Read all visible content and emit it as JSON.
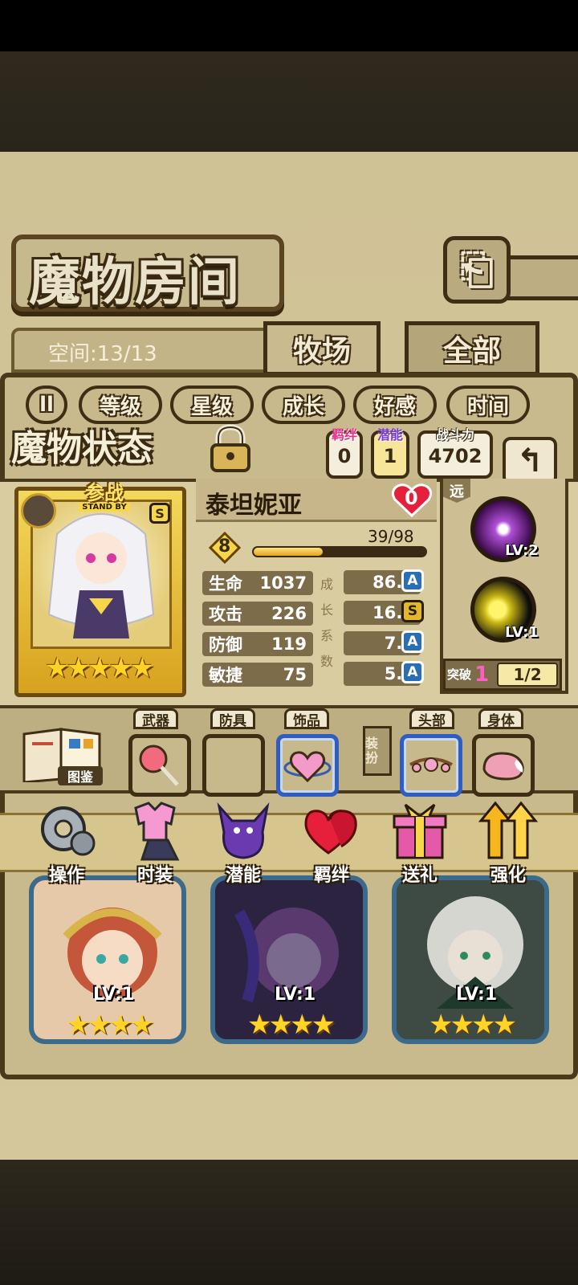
{
  "header": {
    "title": "魔物房间",
    "back_icon": "back-arrow-icon"
  },
  "room": {
    "space_text": "空间:13/13",
    "tabs": [
      {
        "label": "牧场",
        "active": true
      },
      {
        "label": "全部",
        "active": false
      }
    ]
  },
  "sort": {
    "pause_icon": "ll",
    "buttons": [
      "等级",
      "星级",
      "成长",
      "好感",
      "时间"
    ]
  },
  "status": {
    "title": "魔物状态",
    "bond_label": "羁绊",
    "bond_value": "0",
    "potential_label": "潜能",
    "potential_value": "1",
    "power_label": "战斗力",
    "power_value": "4702",
    "return_icon": "return-icon"
  },
  "monster": {
    "standby_cn": "参战",
    "standby_en": "STAND BY",
    "rank": "S",
    "stars": "★★★★★",
    "name": "泰坦妮亚",
    "affinity": "0",
    "level": "8",
    "exp_text": "39/98",
    "exp_fraction": 0.4,
    "stats": [
      {
        "label": "生命",
        "value": "1037",
        "growth": "86.5",
        "grade": "A"
      },
      {
        "label": "攻击",
        "value": "226",
        "growth": "16.6",
        "grade": "S"
      },
      {
        "label": "防御",
        "value": "119",
        "growth": "7.5",
        "grade": "A"
      },
      {
        "label": "敏捷",
        "value": "75",
        "growth": "5.0",
        "grade": "A"
      }
    ],
    "growth_label": [
      "成",
      "长",
      "系",
      "数"
    ]
  },
  "skills": {
    "range": "远",
    "items": [
      {
        "name": "dark-burst-skill-icon",
        "level": "LV:2"
      },
      {
        "name": "yellow-shot-skill-icon",
        "level": "LV:1"
      }
    ],
    "breakthrough_label": "突破",
    "breakthrough_count": "1",
    "breakthrough_ratio": "1/2"
  },
  "equipment": {
    "handbook_label": "图鉴",
    "dress_tag": "装扮",
    "slots": [
      {
        "label": "武器",
        "item": "lollipop-icon"
      },
      {
        "label": "防具",
        "item": ""
      },
      {
        "label": "饰品",
        "item": "heart-ring-icon"
      },
      {
        "label": "头部",
        "item": "flower-headband-icon"
      },
      {
        "label": "身体",
        "item": "fox-tail-icon"
      }
    ]
  },
  "actions": [
    "操作",
    "时装",
    "潜能",
    "羁绊",
    "送礼",
    "强化"
  ],
  "grid": {
    "cards": [
      {
        "level": "LV:1",
        "stars": "★★★★"
      },
      {
        "level": "LV:1",
        "stars": "★★★★"
      },
      {
        "level": "LV:1",
        "stars": "★★★★"
      }
    ]
  },
  "colors": {
    "gold": "#f6d64a",
    "frame_dark": "#3d2e14",
    "grade_a": "#2a6fb5",
    "grade_s": "#e0b82a",
    "breakthrough_pink": "#ff5ec2"
  }
}
